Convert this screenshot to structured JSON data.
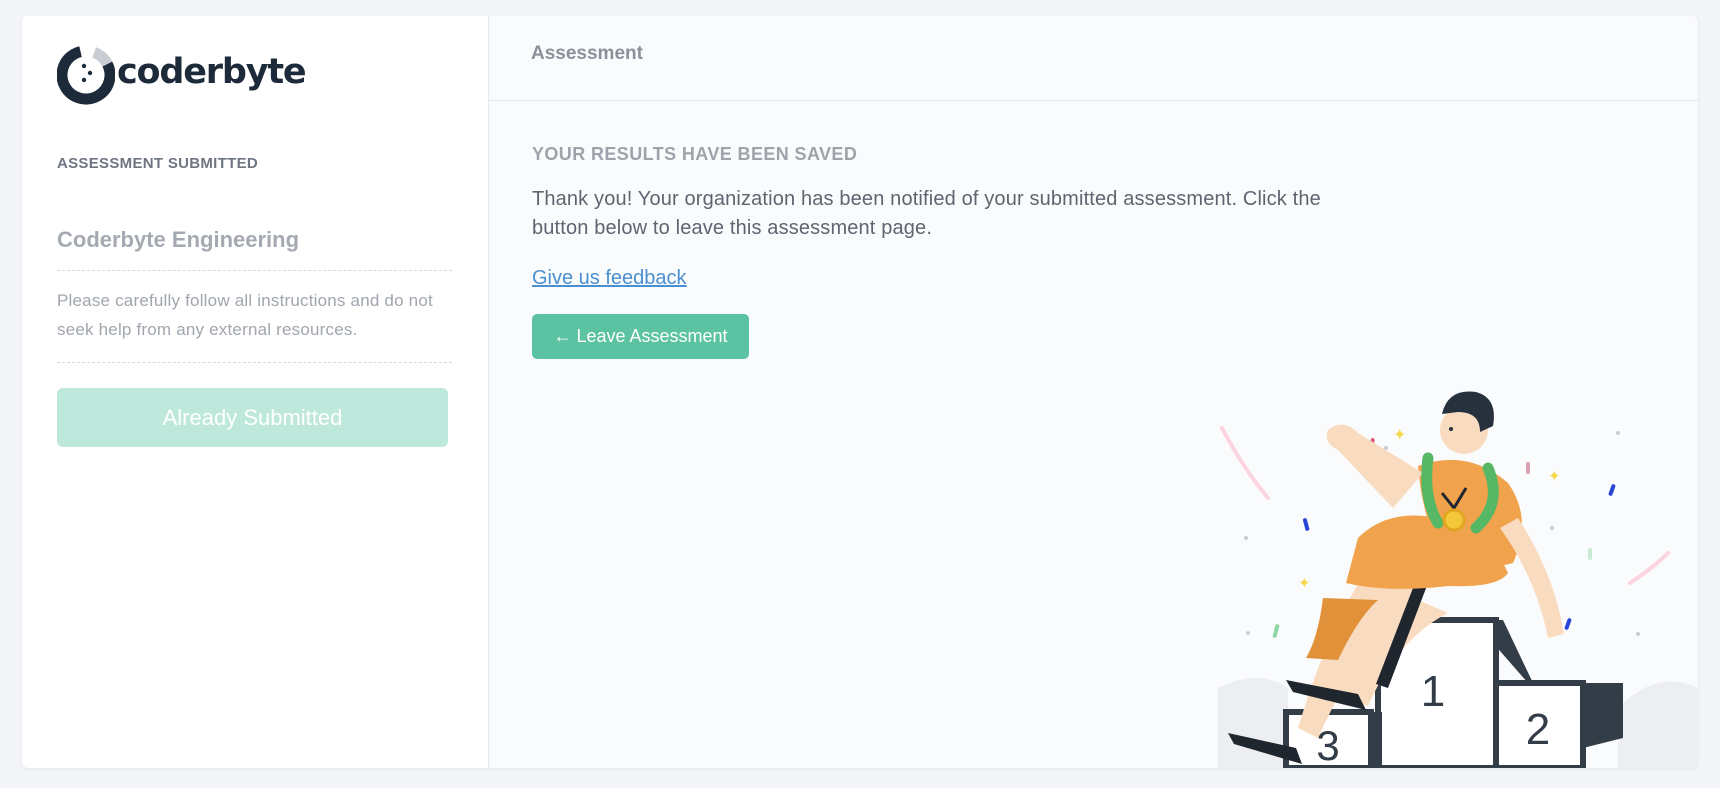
{
  "brand": {
    "name": "coderbyte"
  },
  "sidebar": {
    "status_label": "ASSESSMENT SUBMITTED",
    "organization": "Coderbyte Engineering",
    "instructions": "Please carefully follow all instructions and do not seek help from any external resources.",
    "submitted_button": "Already Submitted"
  },
  "header": {
    "title": "Assessment"
  },
  "main": {
    "heading": "YOUR RESULTS HAVE BEEN SAVED",
    "message": "Thank you! Your organization has been notified of your submitted assessment. Click the button below to leave this assessment page.",
    "feedback_link": "Give us feedback",
    "leave_button": "← Leave Assessment"
  },
  "podium": {
    "first": "1",
    "second": "2",
    "third": "3"
  },
  "colors": {
    "accent": "#5bc2a2",
    "accent_disabled": "#bfe8dc",
    "link": "#4a8fcf",
    "brand_dark": "#1d2a3a"
  }
}
